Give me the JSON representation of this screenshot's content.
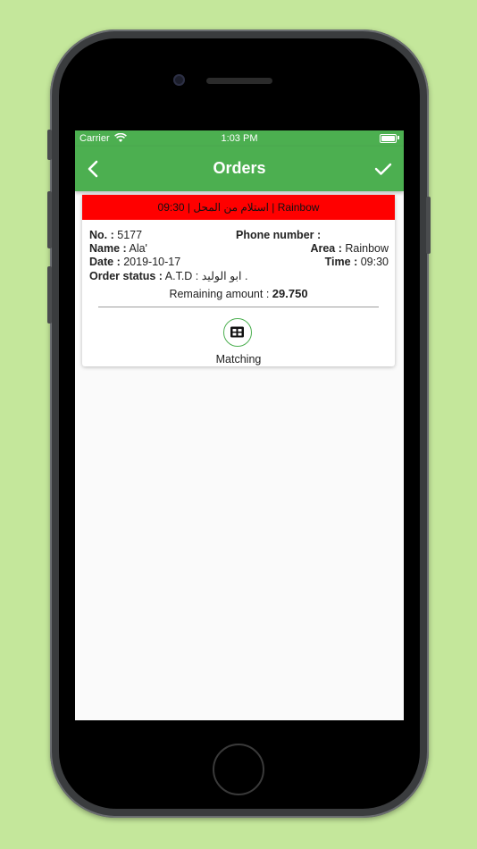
{
  "status_bar": {
    "carrier": "Carrier",
    "time": "1:03 PM",
    "wifi_icon": "wifi-icon",
    "battery_icon": "battery-icon"
  },
  "app_bar": {
    "title": "Orders",
    "back_icon": "chevron-left-icon",
    "confirm_icon": "check-icon",
    "color": "#4caf50"
  },
  "orders": [
    {
      "banner": "استلام من المحل | 09:30 | Rainbow",
      "banner_color": "#ff0000",
      "no_label": "No. :",
      "no_value": "5177",
      "phone_label": "Phone number :",
      "phone_value": "",
      "name_label": "Name :",
      "name_value": "Ala'",
      "area_label": "Area :",
      "area_value": "Rainbow",
      "date_label": "Date :",
      "date_value": "2019-10-17",
      "time_label": "Time :",
      "time_value": "09:30",
      "status_label": "Order status :",
      "status_value": "A.T.D : ابو الوليد .",
      "remaining_label": "Remaining amount :",
      "remaining_value": "29.750",
      "matching_label": "Matching",
      "matching_icon": "grid-icon"
    }
  ]
}
